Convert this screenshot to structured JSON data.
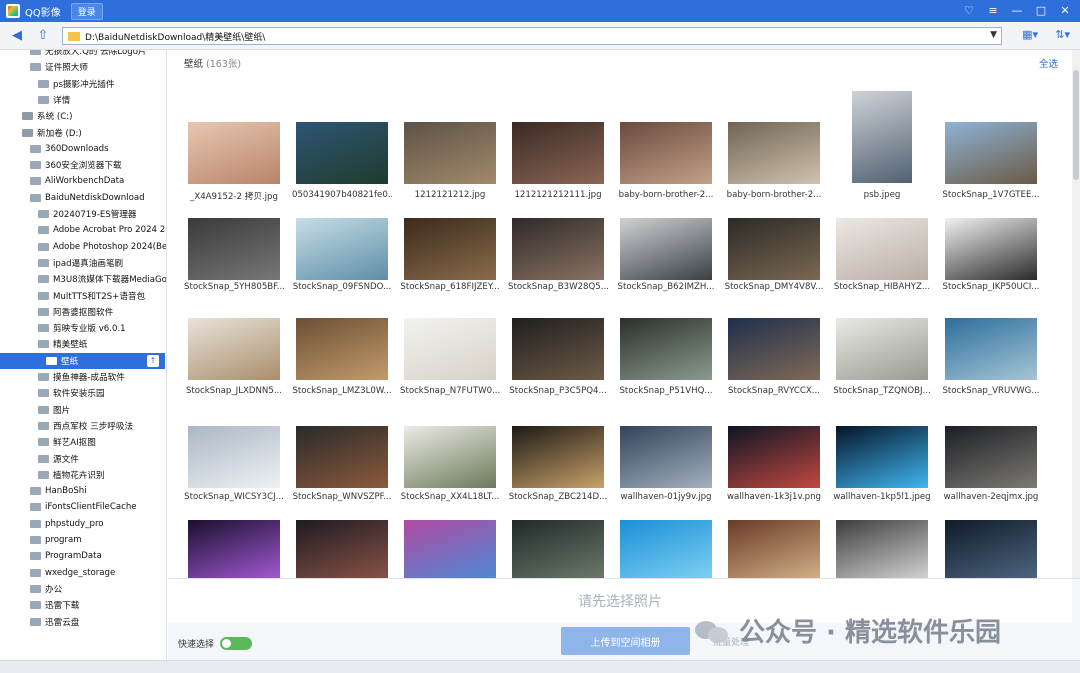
{
  "app": {
    "title": "QQ影像",
    "login_label": "登录"
  },
  "window_controls": [
    "skin-icon",
    "menu-icon",
    "minimize-icon",
    "maximize-icon",
    "close-icon"
  ],
  "toolbar": {
    "path": "D:\\BaiduNetdiskDownload\\精美壁纸\\壁纸\\"
  },
  "sidebar": {
    "items": [
      {
        "label": "无损放大.Q的 去除Logo片"
      },
      {
        "label": "证件照大师"
      },
      {
        "label": "ps摄影冲光插件"
      },
      {
        "label": "详情"
      },
      {
        "label": "系统 (C:)"
      },
      {
        "label": "新加卷 (D:)"
      },
      {
        "label": "360Downloads"
      },
      {
        "label": "360安全浏览器下载"
      },
      {
        "label": "AliWorkbenchData"
      },
      {
        "label": "BaiduNetdiskDownload"
      },
      {
        "label": "20240719-ES管理器"
      },
      {
        "label": "Adobe Acrobat Pro 2024 20"
      },
      {
        "label": "Adobe Photoshop 2024(Bet"
      },
      {
        "label": "ipad逼真油画笔刷"
      },
      {
        "label": "M3U8流媒体下载器MediaGo"
      },
      {
        "label": "MultTTS和T2S+语音包"
      },
      {
        "label": "阿香婆抠图软件"
      },
      {
        "label": "剪映专业版 v6.0.1"
      },
      {
        "label": "精美壁纸"
      },
      {
        "label": "壁纸"
      },
      {
        "label": "摸鱼神器-成品软件"
      },
      {
        "label": "软件安装乐园"
      },
      {
        "label": "图片"
      },
      {
        "label": "西点军校 三步呼吸法"
      },
      {
        "label": "鲜艺AI抠图"
      },
      {
        "label": "源文件"
      },
      {
        "label": "植物花卉识别"
      },
      {
        "label": "HanBoShi"
      },
      {
        "label": "iFontsClientFileCache"
      },
      {
        "label": "phpstudy_pro"
      },
      {
        "label": "program"
      },
      {
        "label": "ProgramData"
      },
      {
        "label": "wxedge_storage"
      },
      {
        "label": "办公"
      },
      {
        "label": "迅雷下载"
      },
      {
        "label": "迅雷云盘"
      }
    ]
  },
  "main": {
    "folder_title": "壁纸",
    "count_label": "(163张)",
    "select_all": "全选",
    "photos": [
      {
        "name": "_X4A9152-2 拷贝.jpg",
        "colors": [
          "#e7c7b2",
          "#b98469"
        ]
      },
      {
        "name": "050341907b40821fe0...",
        "colors": [
          "#2e5675",
          "#203b2c"
        ]
      },
      {
        "name": "1212121212.jpg",
        "colors": [
          "#5d5247",
          "#a28a6b"
        ]
      },
      {
        "name": "1212121212111.jpg",
        "colors": [
          "#3a2a25",
          "#8b6654"
        ]
      },
      {
        "name": "baby-born-brother-2...",
        "colors": [
          "#6b4b3f",
          "#c4a089"
        ]
      },
      {
        "name": "baby-born-brother-2...",
        "colors": [
          "#6f6454",
          "#d0c2ad"
        ]
      },
      {
        "name": "psb.jpeg",
        "colors": [
          "#cfd3d8",
          "#516071"
        ]
      },
      {
        "name": "StockSnap_1V7GTEE...",
        "colors": [
          "#8fb3d7",
          "#6a5a44"
        ]
      },
      {
        "name": "StockSnap_5YH805BF...",
        "colors": [
          "#3a3a3a",
          "#777777"
        ]
      },
      {
        "name": "StockSnap_09FSNDO...",
        "colors": [
          "#c7dde6",
          "#5d8ea7"
        ]
      },
      {
        "name": "StockSnap_618FIJZEY...",
        "colors": [
          "#3b2a1d",
          "#8a6c4a"
        ]
      },
      {
        "name": "StockSnap_B3W28Q5...",
        "colors": [
          "#2f2a29",
          "#8a7262"
        ]
      },
      {
        "name": "StockSnap_B62IMZH...",
        "colors": [
          "#cfd2d4",
          "#3a3f44"
        ]
      },
      {
        "name": "StockSnap_DMY4V8V...",
        "colors": [
          "#2c2a27",
          "#7a6851"
        ]
      },
      {
        "name": "StockSnap_HIBAHYZ...",
        "colors": [
          "#ece8e4",
          "#b9aea4"
        ]
      },
      {
        "name": "StockSnap_IKP50UCI...",
        "colors": [
          "#f2f2f2",
          "#2a2a2a"
        ]
      },
      {
        "name": "StockSnap_JLXDNN5...",
        "colors": [
          "#e9e3da",
          "#a98e6b"
        ]
      },
      {
        "name": "StockSnap_LMZ3L0W...",
        "colors": [
          "#6b4f35",
          "#c39b6b"
        ]
      },
      {
        "name": "StockSnap_N7FUTW0...",
        "colors": [
          "#f2f2f0",
          "#d7d2c8"
        ]
      },
      {
        "name": "StockSnap_P3C5PQ4...",
        "colors": [
          "#1f1f1f",
          "#6d5a47"
        ]
      },
      {
        "name": "StockSnap_P51VHQ...",
        "colors": [
          "#2b2f2a",
          "#8a9b8f"
        ]
      },
      {
        "name": "StockSnap_RVYCCX...",
        "colors": [
          "#1f2f4d",
          "#7f6a56"
        ]
      },
      {
        "name": "StockSnap_TZQNOBJ...",
        "colors": [
          "#e9e9e6",
          "#9a9a92"
        ]
      },
      {
        "name": "StockSnap_VRUVWG...",
        "colors": [
          "#2c6e9c",
          "#a6c5d6"
        ]
      },
      {
        "name": "StockSnap_WICSY3CJ...",
        "colors": [
          "#aab7c4",
          "#eef1f4"
        ]
      },
      {
        "name": "StockSnap_WNVSZPF...",
        "colors": [
          "#2a2a2a",
          "#8c5a3c"
        ]
      },
      {
        "name": "StockSnap_XX4L18LT...",
        "colors": [
          "#eceae5",
          "#6b7a5a"
        ]
      },
      {
        "name": "StockSnap_ZBC214D...",
        "colors": [
          "#1d1a15",
          "#c9a16a"
        ]
      },
      {
        "name": "wallhaven-01jy9v.jpg",
        "colors": [
          "#32435a",
          "#a3b1bf"
        ]
      },
      {
        "name": "wallhaven-1k3j1v.png",
        "colors": [
          "#0d1524",
          "#c2483f"
        ]
      },
      {
        "name": "wallhaven-1kp5l1.jpeg",
        "colors": [
          "#071428",
          "#3fb6f0"
        ]
      },
      {
        "name": "wallhaven-2eqjmx.jpg",
        "colors": [
          "#1b1e24",
          "#7d7a74"
        ]
      },
      {
        "name": "",
        "colors": [
          "#1b0f2e",
          "#a35ad6"
        ]
      },
      {
        "name": "",
        "colors": [
          "#1f1a22",
          "#8a5446"
        ]
      },
      {
        "name": "",
        "colors": [
          "#b24aa0",
          "#4b8ad6"
        ]
      },
      {
        "name": "",
        "colors": [
          "#1f2a2a",
          "#6c7a6a"
        ]
      },
      {
        "name": "",
        "colors": [
          "#1a8fd6",
          "#7fd1f4"
        ]
      },
      {
        "name": "",
        "colors": [
          "#6a3a25",
          "#d3b28a"
        ]
      },
      {
        "name": "",
        "colors": [
          "#3d3d3d",
          "#d5d5d5"
        ]
      },
      {
        "name": "",
        "colors": [
          "#0e1b2a",
          "#4f6680"
        ]
      }
    ]
  },
  "bottom": {
    "hint": "请先选择照片",
    "quick_select": "快速选择",
    "upload_label": "上传到空间相册",
    "batch_label": "批量处理"
  },
  "watermark": "公众号 · 精选软件乐园"
}
